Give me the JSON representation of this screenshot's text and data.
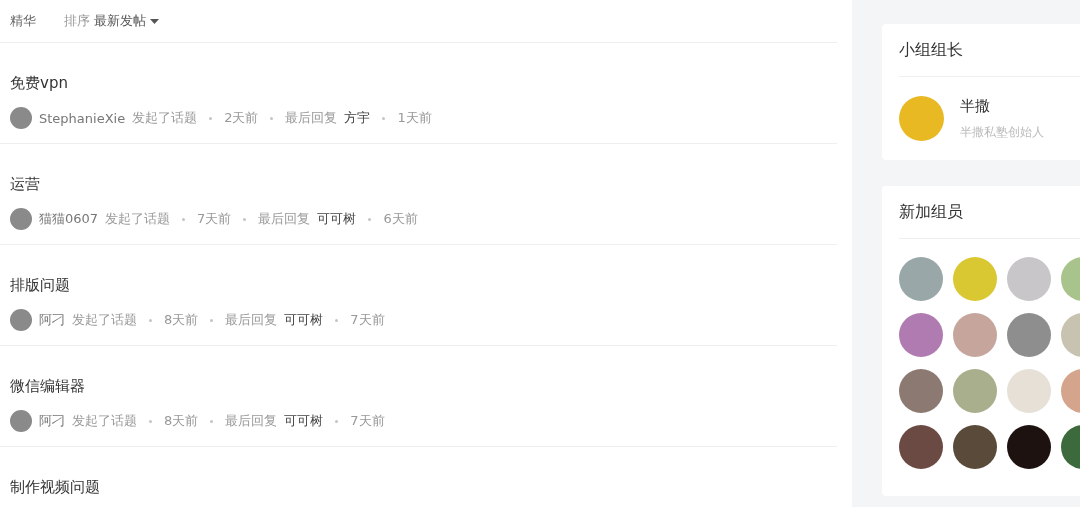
{
  "filter_bar": {
    "tabs": [
      {
        "label": "精华",
        "selected": false
      }
    ],
    "sort_label": "排序",
    "sort_value": "最新发帖"
  },
  "topics": [
    {
      "title": "免费vpn",
      "author": "StephanieXie",
      "action": "发起了话题",
      "posted": "2天前",
      "reply_label": "最后回复",
      "replier": "方宇",
      "replied": "1天前"
    },
    {
      "title": "运营",
      "author": "猫猫0607",
      "action": "发起了话题",
      "posted": "7天前",
      "reply_label": "最后回复",
      "replier": "可可树",
      "replied": "6天前"
    },
    {
      "title": "排版问题",
      "author": "阿刁",
      "action": "发起了话题",
      "posted": "8天前",
      "reply_label": "最后回复",
      "replier": "可可树",
      "replied": "7天前"
    },
    {
      "title": "微信编辑器",
      "author": "阿刁",
      "action": "发起了话题",
      "posted": "8天前",
      "reply_label": "最后回复",
      "replier": "可可树",
      "replied": "7天前"
    },
    {
      "title": "制作视频问题"
    }
  ],
  "leader_card": {
    "title": "小组组长",
    "name": "半撒",
    "bio": "半撒私塾创始人"
  },
  "members_card": {
    "title": "新加组员",
    "members": [
      {
        "color": "#9aa7a8"
      },
      {
        "color": "#d9c832"
      },
      {
        "color": "#c9c6c9"
      },
      {
        "color": "#a8c48c"
      },
      {
        "color": "#b07bb0"
      },
      {
        "color": "#c6a59c"
      },
      {
        "color": "#8e8e8e"
      },
      {
        "color": "#c8c2b0"
      },
      {
        "color": "#8c7a72"
      },
      {
        "color": "#a9ae8c"
      },
      {
        "color": "#e6e0d6"
      },
      {
        "color": "#d4a58c"
      },
      {
        "color": "#6c4a44"
      },
      {
        "color": "#5a4a3a"
      },
      {
        "color": "#1e1210"
      },
      {
        "color": "#3c6a3c"
      }
    ]
  }
}
